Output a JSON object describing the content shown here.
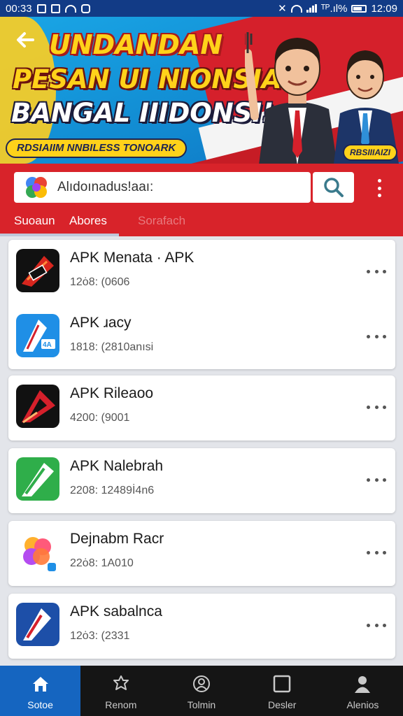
{
  "status_bar": {
    "time": "00:33",
    "signal_text": "ᵀᴾ.ıl%",
    "clock": "12:09"
  },
  "banner": {
    "back_icon": "arrow-left-icon",
    "headline_1": "UNDANDAN",
    "headline_2": "PESAN UI NIONSIA",
    "headline_3": "BANGAL IIIDONSI!",
    "pill_left": "RDSIAIIM NNBILESS TONOARK",
    "pill_right": "RBSIIIAIZI",
    "colors": {
      "red": "#d5202b",
      "yellow": "#ffd21a",
      "blue": "#1391d6"
    }
  },
  "search": {
    "text": "Alıdoınadus!aaı:",
    "app_icon": "colorful-logo-icon",
    "button_icon": "search-icon",
    "menu_icon": "kebab-menu-icon"
  },
  "tabs": [
    {
      "label": "Suoaun"
    },
    {
      "label": "Abores"
    },
    {
      "label": "Sorafach"
    }
  ],
  "apps": [
    {
      "title": "APK Menata · APK",
      "meta": "12ȯ8: (0606",
      "icon": "red-arrow-app-icon"
    },
    {
      "title": "APK ɹacy",
      "meta": "1818: (2810anısi",
      "icon": "blue-a-app-icon"
    },
    {
      "title": "APK Rileaoo",
      "meta": "4200: (9001",
      "icon": "red-black-app-icon"
    },
    {
      "title": "APK Nalebrah",
      "meta": "2208: 12489İ4n6",
      "icon": "green-arrow-app-icon"
    },
    {
      "title": "Dejnabm Racr",
      "meta": "22ȯ8: 1A010",
      "icon": "gradient-flower-app-icon"
    },
    {
      "title": "APK sabalnca",
      "meta": "12ȯ3: (2331",
      "icon": "navy-a-app-icon"
    }
  ],
  "bottom_nav": [
    {
      "label": "Sotoe",
      "icon": "home-icon"
    },
    {
      "label": "Renom",
      "icon": "badge-icon"
    },
    {
      "label": "Tolmin",
      "icon": "profile-icon"
    },
    {
      "label": "Desler",
      "icon": "square-icon"
    },
    {
      "label": "Alenios",
      "icon": "person-icon"
    }
  ]
}
